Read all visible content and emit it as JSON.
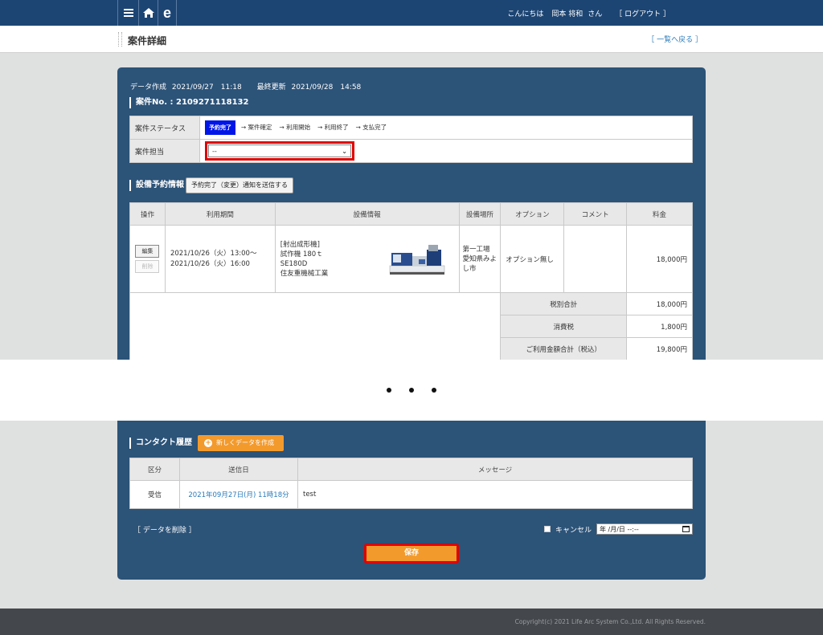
{
  "header": {
    "greeting": "こんにちは",
    "user_name": "岡本 将和",
    "honorific": "さん",
    "logout": "［ ログアウト ］",
    "icons": [
      "menu-icon",
      "home-icon",
      "e-logo-icon"
    ]
  },
  "titlebar": {
    "title": "案件詳細",
    "back_link": "［ 一覧へ戻る ］"
  },
  "meta": {
    "created_label": "データ作成",
    "created_value": "2021/09/27　11:18",
    "updated_label": "最終更新",
    "updated_value": "2021/09/28　14:58"
  },
  "case": {
    "number_label": "案件No. : 2109271118132",
    "status_label": "案件ステータス",
    "status_current": "予約完了",
    "status_steps": [
      "→ 案件確定",
      "→ 利用開始",
      "→ 利用終了",
      "→ 支払完了"
    ],
    "assignee_label": "案件担当",
    "assignee_value": "--"
  },
  "equipment": {
    "section_title": "設備予約情報",
    "notify_button": "予約完了（変更）通知を送信する",
    "columns": [
      "操作",
      "利用期間",
      "設備情報",
      "設備場所",
      "オプション",
      "コメント",
      "料金"
    ],
    "rows": [
      {
        "edit_button": "編集",
        "delete_button": "削除",
        "period_line1": "2021/10/26（火）13:00〜",
        "period_line2": "2021/10/26（火）16:00",
        "info_line1": "[射出成形機]",
        "info_line2": "試作機 180ｔ",
        "info_line3": "SE180D",
        "info_line4": "住友重機械工業",
        "location": "第一工場 愛知県みよし市",
        "option": "オプション無し",
        "comment": "",
        "price": "18,000円"
      }
    ],
    "summary": [
      {
        "label": "税別合計",
        "value": "18,000円"
      },
      {
        "label": "消費税",
        "value": "1,800円"
      },
      {
        "label": "ご利用金額合計（税込）",
        "value": "19,800円"
      }
    ]
  },
  "contact": {
    "section_title": "コンタクト履歴",
    "create_button": "新しくデータを作成",
    "columns": [
      "区分",
      "送信日",
      "メッセージ"
    ],
    "rows": [
      {
        "type": "受信",
        "date": "2021年09月27日(月) 11時18分",
        "message": "test"
      }
    ]
  },
  "actions": {
    "delete_link": "［ データを削除 ］",
    "cancel_label": "キャンセル",
    "date_placeholder": "年 /月/日 --:--",
    "save_button": "保存"
  },
  "footer": {
    "copyright": "Copyright(c) 2021 Life Arc System Co.,Ltd. All Rights Reserved."
  },
  "colors": {
    "header_bg": "#1d4573",
    "panel_bg": "#2c5378",
    "accent_orange": "#f39a2c",
    "status_badge": "#0016e8",
    "highlight_red": "#e00000",
    "link_blue": "#2b7bb9",
    "footer_bg": "#44474b"
  }
}
